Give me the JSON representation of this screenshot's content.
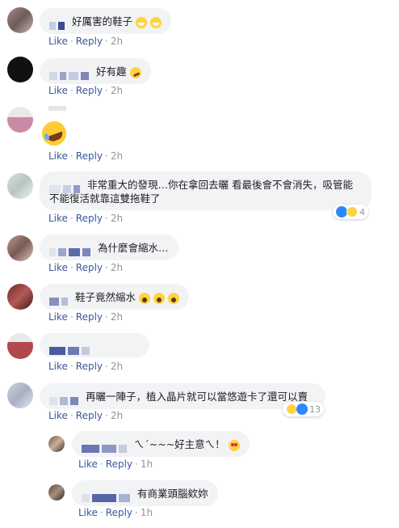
{
  "actions": {
    "like": "Like",
    "reply": "Reply",
    "dot": "·"
  },
  "comments": [
    {
      "text": "好厲害的鞋子",
      "time": "2h"
    },
    {
      "text": "好有趣",
      "time": "2h"
    },
    {
      "text": "",
      "time": "2h"
    },
    {
      "text": "非常重大的發現…你在拿回去曬 看最後會不會消失，吸管能",
      "text2": "不能復活就靠這雙拖鞋了",
      "time": "2h",
      "reactions": "4"
    },
    {
      "text": "為什麼會縮水…",
      "time": "2h"
    },
    {
      "text": "鞋子竟然縮水",
      "time": "2h"
    },
    {
      "text": "",
      "time": "2h"
    },
    {
      "text": "再曬一陣子，植入晶片就可以當悠遊卡了還可以賣",
      "time": "2h",
      "reactions": "13"
    }
  ],
  "replies": [
    {
      "text": "ㄟ´~~~好主意ㄟ！",
      "time": "1h"
    },
    {
      "text": "有商業頭腦欸妳",
      "time": "1h"
    }
  ],
  "colors": {
    "link": "#385898",
    "bubble": "#f2f3f5",
    "like": "#2d88ff"
  }
}
